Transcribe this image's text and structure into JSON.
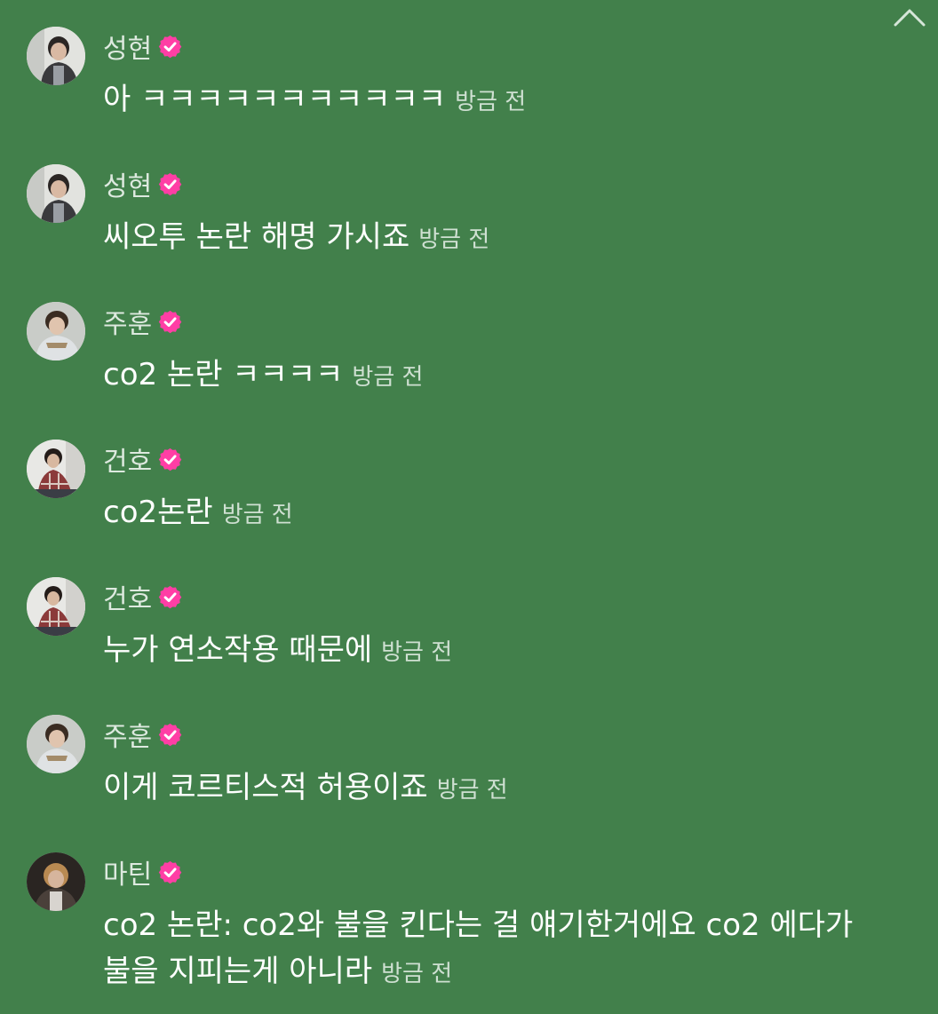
{
  "colors": {
    "background": "#42804b",
    "badge": "#ff3ea5",
    "name": "#dde9df",
    "time": "#cfe0d2"
  },
  "collapse_icon": "chevron-up-icon",
  "messages": [
    {
      "user": "성현",
      "text": "아 ㅋㅋㅋㅋㅋㅋㅋㅋㅋㅋㅋ",
      "time": "방금 전",
      "avatar": "seonghyeon"
    },
    {
      "user": "성현",
      "text": "씨오투 논란 해명 가시죠",
      "time": "방금 전",
      "avatar": "seonghyeon"
    },
    {
      "user": "주훈",
      "text": "co2 논란 ㅋㅋㅋㅋ",
      "time": "방금 전",
      "avatar": "juhun"
    },
    {
      "user": "건호",
      "text": "co2논란",
      "time": "방금 전",
      "avatar": "geonho"
    },
    {
      "user": "건호",
      "text": "누가 연소작용 때문에",
      "time": "방금 전",
      "avatar": "geonho"
    },
    {
      "user": "주훈",
      "text": "이게 코르티스적 허용이죠",
      "time": "방금 전",
      "avatar": "juhun"
    },
    {
      "user": "마틴",
      "text": "co2 논란: co2와 불을 킨다는 걸 얘기한거에요 co2 에다가 불을 지피는게 아니라",
      "time": "방금 전",
      "avatar": "martin"
    }
  ]
}
